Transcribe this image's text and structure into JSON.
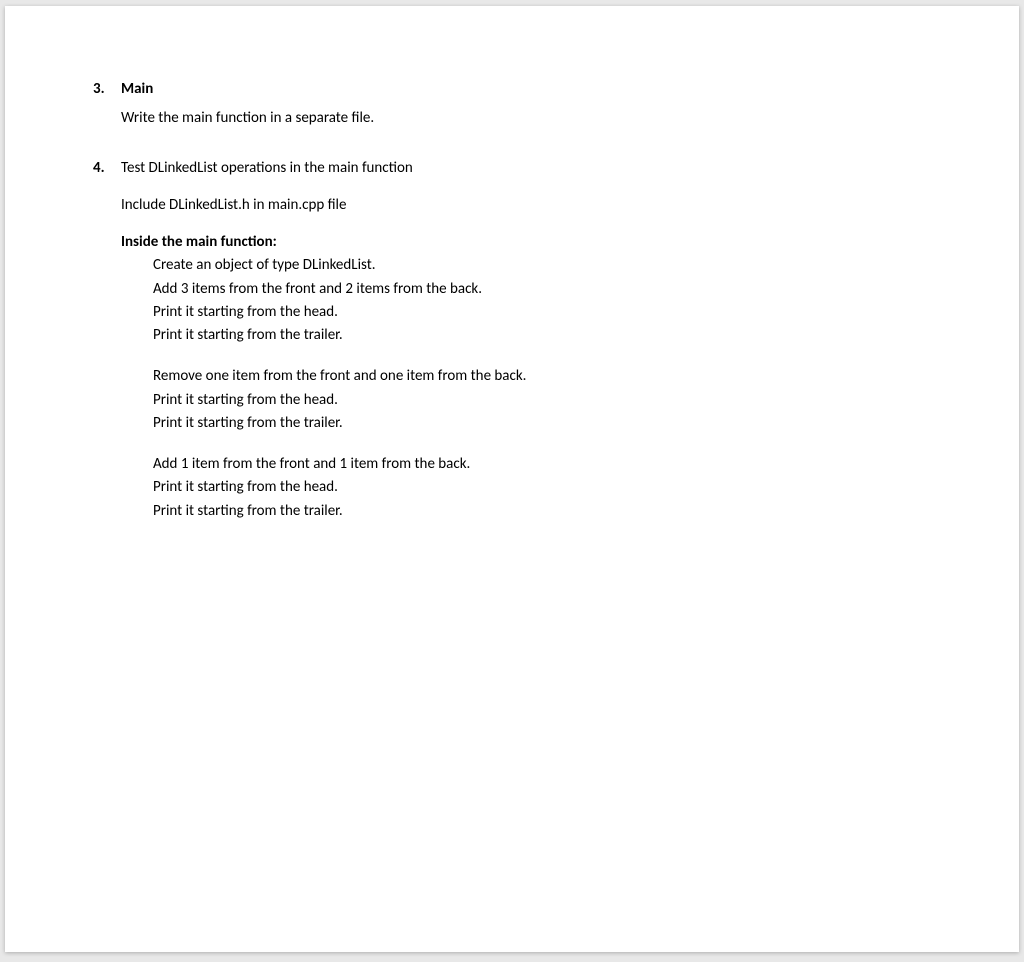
{
  "item3": {
    "num": "3.",
    "title": "Main",
    "body": "Write the main function in a separate file."
  },
  "item4": {
    "num": "4.",
    "title": "Test DLinkedList operations in the main function",
    "include": "Include DLinkedList.h in main.cpp file",
    "inside_heading": "Inside the main function:",
    "block1": [
      "Create an object of type DLinkedList.",
      "Add 3 items from the front and 2 items from the back.",
      "Print it starting from the head.",
      "Print it starting from the trailer."
    ],
    "block2": [
      "Remove one item from the front and one item from the back.",
      "Print it starting from the head.",
      "Print it starting from the trailer."
    ],
    "block3": [
      "Add 1 item from the front and 1 item from the back.",
      "Print it starting from the head.",
      "Print it starting from the trailer."
    ]
  }
}
